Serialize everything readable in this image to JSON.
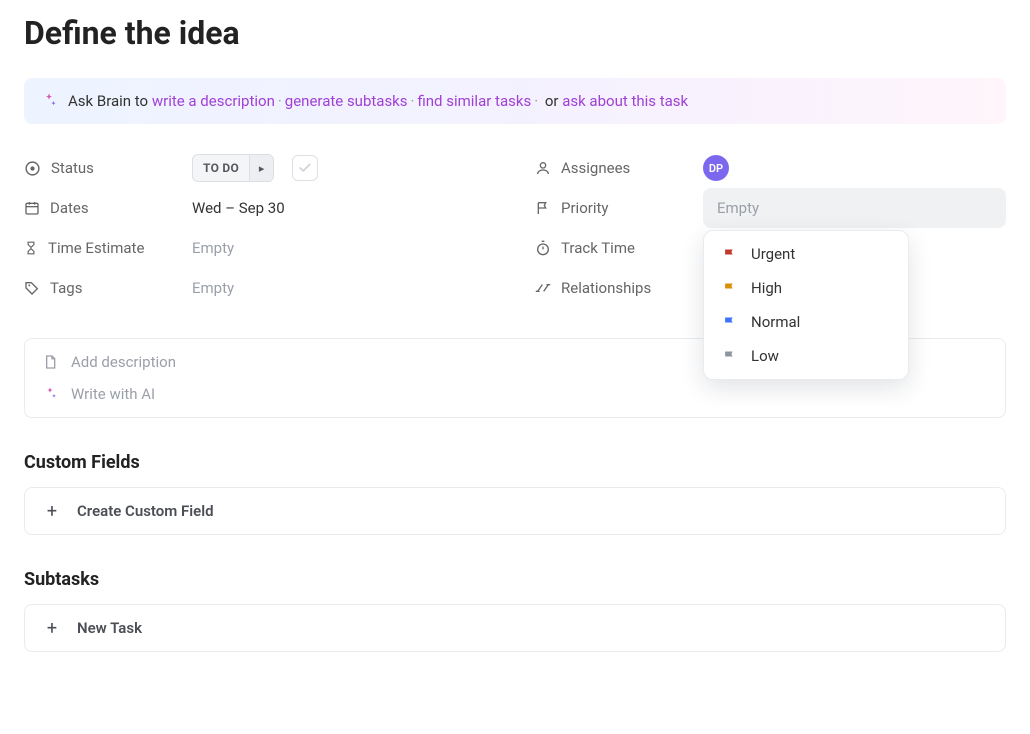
{
  "title": "Define the idea",
  "ai": {
    "prefix": "Ask Brain to ",
    "links": [
      "write a description",
      "generate subtasks",
      "find similar tasks"
    ],
    "or": " or ",
    "final_link": "ask about this task"
  },
  "left_fields": {
    "status": {
      "label": "Status",
      "pill": "TO DO"
    },
    "dates": {
      "label": "Dates",
      "value": "Wed – Sep 30"
    },
    "time_estimate": {
      "label": "Time Estimate",
      "value": "Empty"
    },
    "tags": {
      "label": "Tags",
      "value": "Empty"
    }
  },
  "right_fields": {
    "assignees": {
      "label": "Assignees",
      "avatar": "DP"
    },
    "priority": {
      "label": "Priority",
      "placeholder": "Empty"
    },
    "track_time": {
      "label": "Track Time"
    },
    "relationships": {
      "label": "Relationships"
    }
  },
  "priority_options": [
    {
      "label": "Urgent",
      "color": "#c0392b"
    },
    {
      "label": "High",
      "color": "#d98e04"
    },
    {
      "label": "Normal",
      "color": "#3f6fff"
    },
    {
      "label": "Low",
      "color": "#8f95a0"
    }
  ],
  "description": {
    "add": "Add description",
    "ai": "Write with AI"
  },
  "custom_fields": {
    "title": "Custom Fields",
    "button": "Create Custom Field"
  },
  "subtasks": {
    "title": "Subtasks",
    "button": "New Task"
  }
}
